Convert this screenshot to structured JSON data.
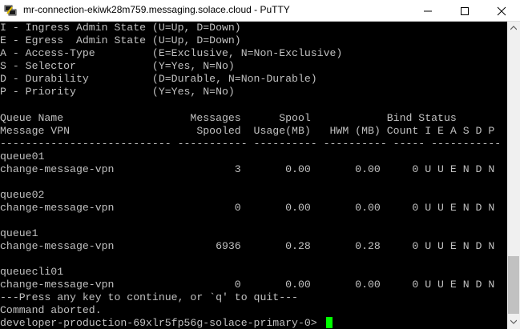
{
  "window": {
    "title": "mr-connection-ekiwk28m759.messaging.solace.cloud - PuTTY",
    "icon": "putty-icon",
    "controls": {
      "minimize_icon": "minimize-icon",
      "maximize_icon": "maximize-icon",
      "close_icon": "close-icon"
    }
  },
  "terminal": {
    "foreground": "#c0c0c0",
    "background": "#000000",
    "cursor_color": "#00ff00",
    "lines": [
      "I - Ingress Admin State (U=Up, D=Down)",
      "E - Egress  Admin State (U=Up, D=Down)",
      "A - Access-Type         (E=Exclusive, N=Non-Exclusive)",
      "S - Selector            (Y=Yes, N=No)",
      "D - Durability          (D=Durable, N=Non-Durable)",
      "P - Priority            (Y=Yes, N=No)",
      "",
      "Queue Name                    Messages      Spool            Bind Status",
      "Message VPN                    Spooled  Usage(MB)   HWM (MB) Count I E A S D P",
      "--------------------------- ----------- ---------- ---------- ----- -----------",
      "queue01",
      "change-message-vpn                   3       0.00       0.00     0 U U E N D N",
      "",
      "queue02",
      "change-message-vpn                   0       0.00       0.00     0 U U E N D N",
      "",
      "queue1",
      "change-message-vpn                6936       0.28       0.28     0 U U E N D N",
      "",
      "queuecli01",
      "change-message-vpn                   0       0.00       0.00     0 U U E N D N",
      "---Press any key to continue, or `q' to quit---",
      "Command aborted.",
      "developer-production-69xlr5fp56g-solace-primary-0> "
    ]
  },
  "scrollbar": {
    "position_fraction": 0.95,
    "up_icon": "scroll-up-arrow-icon",
    "down_icon": "scroll-down-arrow-icon"
  }
}
